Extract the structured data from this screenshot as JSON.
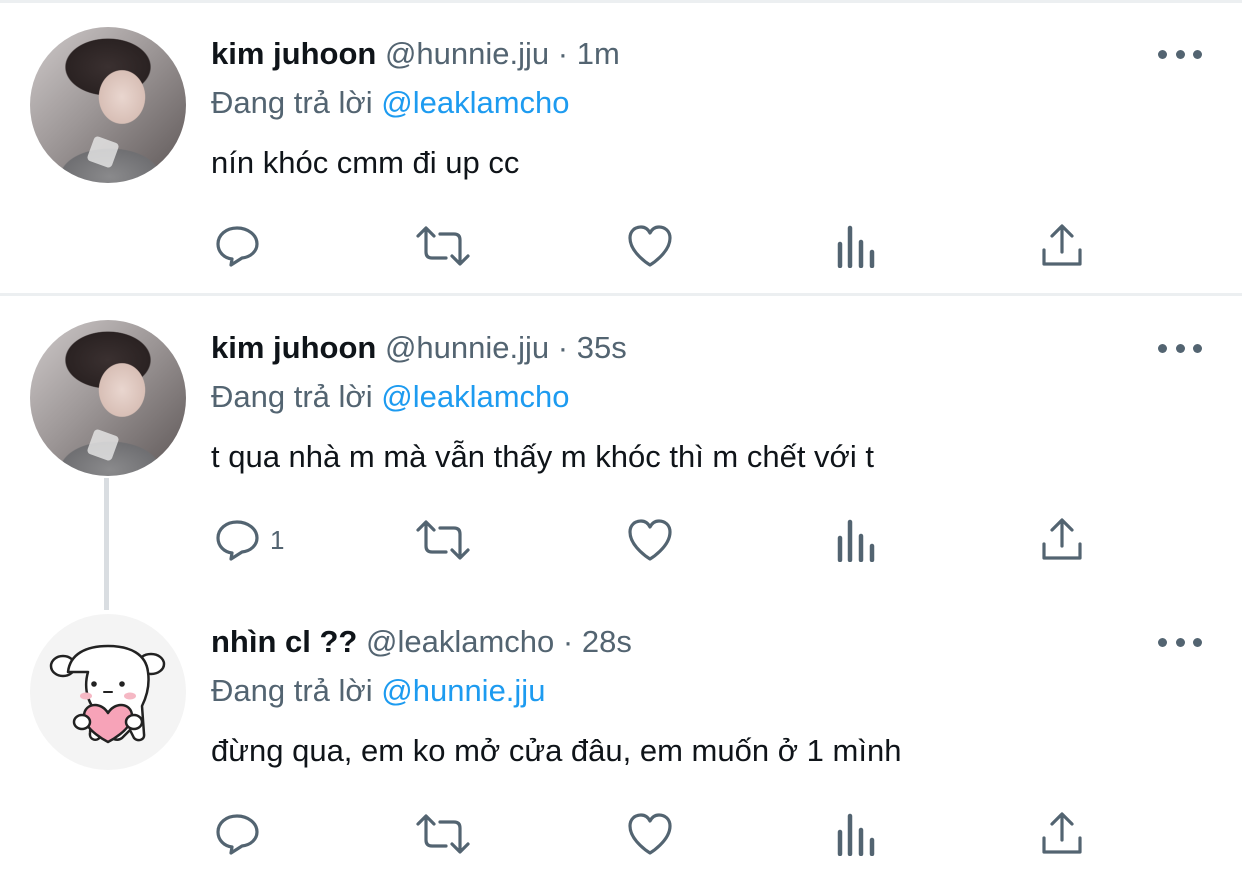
{
  "tweets": [
    {
      "name": "kim juhoon",
      "handle": "@hunnie.jju",
      "dot": "·",
      "time": "1m",
      "replying_prefix": "Đang trả lời",
      "replying_to": "@leaklamcho",
      "text": "nín khóc cmm đi up cc",
      "reply_count": ""
    },
    {
      "name": "kim juhoon",
      "handle": "@hunnie.jju",
      "dot": "·",
      "time": "35s",
      "replying_prefix": "Đang trả lời",
      "replying_to": "@leaklamcho",
      "text": "t qua nhà m mà vẫn thấy m khóc thì m chết với t",
      "reply_count": "1"
    },
    {
      "name": "nhìn cl ??",
      "handle": "@leaklamcho",
      "dot": "·",
      "time": "28s",
      "replying_prefix": "Đang trả lời",
      "replying_to": "@hunnie.jju",
      "text": "đừng qua, em ko mở cửa đâu, em muốn ở 1 mình",
      "reply_count": ""
    }
  ],
  "icons": {
    "reply": "reply-icon",
    "retweet": "retweet-icon",
    "like": "like-icon",
    "views": "views-icon",
    "share": "share-icon",
    "more": "more-icon"
  },
  "colors": {
    "text": "#0f1419",
    "secondary": "#536471",
    "mention": "#1d9bf0",
    "divider": "#eceff1"
  }
}
